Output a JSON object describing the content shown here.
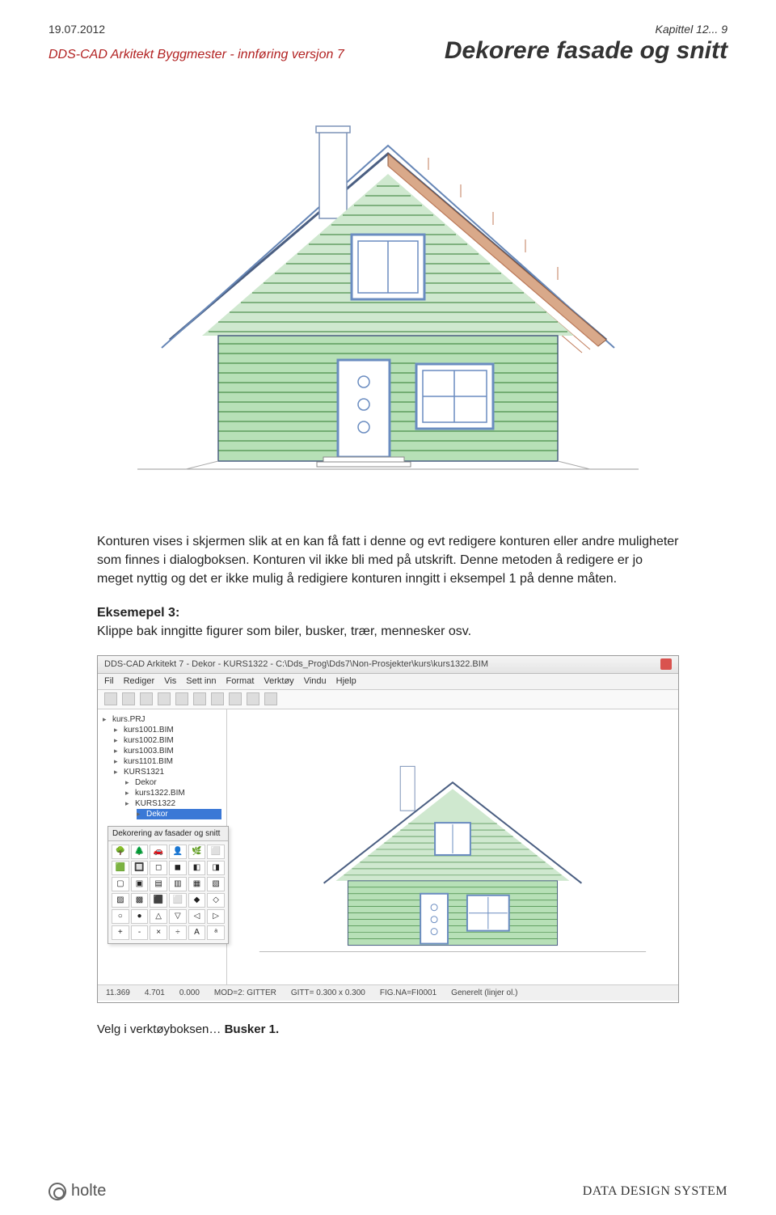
{
  "header": {
    "date": "19.07.2012",
    "chapter": "Kapittel 12... 9",
    "product": "DDS-CAD Arkitekt Byggmester - innføring versjon 7",
    "title": "Dekorere fasade og snitt"
  },
  "body": {
    "para1": "Konturen vises i skjermen slik at en kan få fatt i denne og evt redigere konturen eller andre muligheter som finnes i dialogboksen. Konturen vil ikke bli med på utskrift. Denne metoden å redigere er jo meget nyttig og det er ikke mulig å redigiere konturen inngitt i eksempel 1 på denne måten.",
    "example3_label": "Eksemepel 3:",
    "example3_text": "Klippe bak inngitte figurer som biler, busker, trær, mennesker osv.",
    "velg_prefix": "Velg i verktøyboksen… ",
    "velg_bold": "Busker 1."
  },
  "screenshot": {
    "window_title": "DDS-CAD Arkitekt 7 - Dekor - KURS1322 - C:\\Dds_Prog\\Dds7\\Non-Prosjekter\\kurs\\kurs1322.BIM",
    "menu": [
      "Fil",
      "Rediger",
      "Vis",
      "Sett inn",
      "Format",
      "Verktøy",
      "Vindu",
      "Hjelp"
    ],
    "project_tree": {
      "root": "kurs.PRJ",
      "items": [
        "kurs1001.BIM",
        "kurs1002.BIM",
        "kurs1003.BIM",
        "kurs1101.BIM",
        "KURS1321"
      ],
      "subitems": [
        "Dekor",
        "kurs1322.BIM",
        "KURS1322",
        "Dekor"
      ]
    },
    "palette_title": "Dekorering av fasader og snitt",
    "palette_icons": [
      "🌳",
      "🌲",
      "🚗",
      "👤",
      "🌿",
      "⬜",
      "🟩",
      "🔲",
      "◻",
      "◼",
      "◧",
      "◨",
      "▢",
      "▣",
      "▤",
      "▥",
      "▦",
      "▧",
      "▨",
      "▩",
      "⬛",
      "⬜",
      "◆",
      "◇",
      "○",
      "●",
      "△",
      "▽",
      "◁",
      "▷",
      "+",
      "-",
      "×",
      "÷",
      "A",
      "ᵃ"
    ],
    "status": {
      "x": "11.369",
      "y": "4.701",
      "z": "0.000",
      "mode": "MOD=2: GITTER",
      "grid": "GITT= 0.300 x 0.300",
      "figna": "FIG.NA=FI0001",
      "layer": "Generelt (linjer ol.)"
    }
  },
  "footer": {
    "left": "holte",
    "right": "DATA DESIGN SYSTEM"
  },
  "house_colors": {
    "siding": "#8fc98f",
    "siding_line": "#2f7a2f",
    "frame": "#6787b7",
    "window_frame": "#6a8cc0",
    "roof_tile": "#c07b5a",
    "roof_line": "#8d5a3f",
    "outline": "#4b5f82"
  }
}
